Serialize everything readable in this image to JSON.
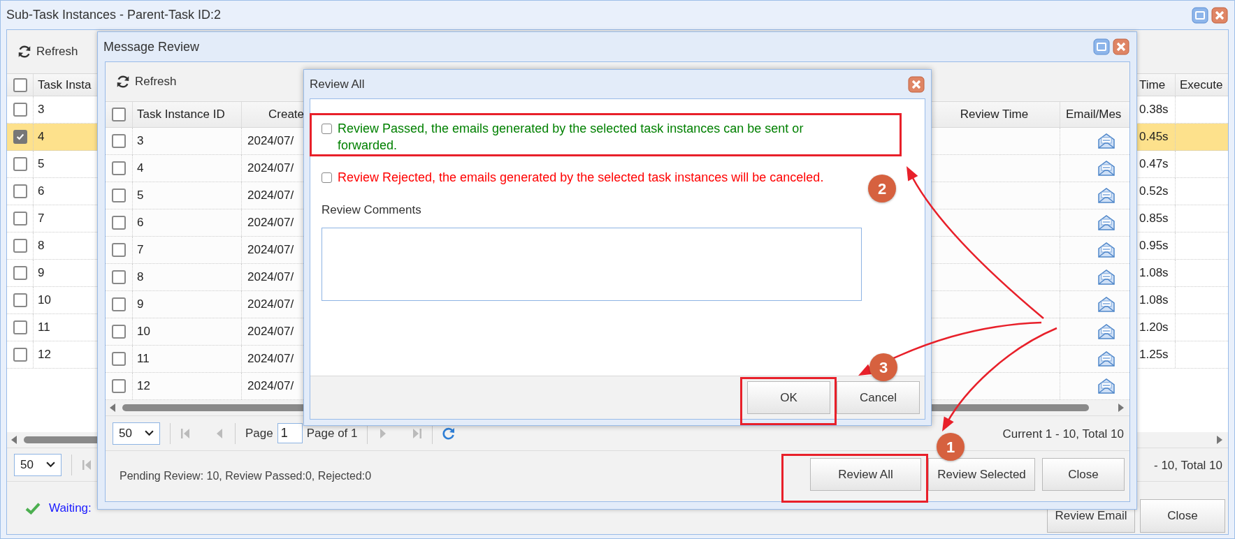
{
  "window": {
    "title": "Sub-Task Instances - Parent-Task ID:2",
    "refresh": "Refresh",
    "table": {
      "header_checked": false,
      "columns": [
        "Task Insta",
        "Time",
        "Execute"
      ],
      "rows": [
        {
          "checked": false,
          "selected": false,
          "id": "3",
          "time": "0.38s"
        },
        {
          "checked": true,
          "selected": true,
          "id": "4",
          "time": "0.45s"
        },
        {
          "checked": false,
          "selected": false,
          "id": "5",
          "time": "0.47s"
        },
        {
          "checked": false,
          "selected": false,
          "id": "6",
          "time": "0.52s"
        },
        {
          "checked": false,
          "selected": false,
          "id": "7",
          "time": "0.85s"
        },
        {
          "checked": false,
          "selected": false,
          "id": "8",
          "time": "0.95s"
        },
        {
          "checked": false,
          "selected": false,
          "id": "9",
          "time": "1.08s"
        },
        {
          "checked": false,
          "selected": false,
          "id": "10",
          "time": "1.08s"
        },
        {
          "checked": false,
          "selected": false,
          "id": "11",
          "time": "1.20s"
        },
        {
          "checked": false,
          "selected": false,
          "id": "12",
          "time": "1.25s"
        }
      ]
    },
    "pagination": {
      "page_size": "50",
      "summary": "- 10, Total 10"
    },
    "status": "Waiting:",
    "buttons": [
      "Review Email",
      "Close"
    ]
  },
  "message_review": {
    "title": "Message Review",
    "refresh": "Refresh",
    "table": {
      "header_checked": false,
      "columns": [
        "Task Instance ID",
        "Create",
        "Review Time",
        "Email/Mes"
      ],
      "rows": [
        {
          "checked": false,
          "id": "3",
          "created": "2024/07/"
        },
        {
          "checked": false,
          "id": "4",
          "created": "2024/07/"
        },
        {
          "checked": false,
          "id": "5",
          "created": "2024/07/"
        },
        {
          "checked": false,
          "id": "6",
          "created": "2024/07/"
        },
        {
          "checked": false,
          "id": "7",
          "created": "2024/07/"
        },
        {
          "checked": false,
          "id": "8",
          "created": "2024/07/"
        },
        {
          "checked": false,
          "id": "9",
          "created": "2024/07/"
        },
        {
          "checked": false,
          "id": "10",
          "created": "2024/07/"
        },
        {
          "checked": false,
          "id": "11",
          "created": "2024/07/"
        },
        {
          "checked": false,
          "id": "12",
          "created": "2024/07/"
        }
      ]
    },
    "pagination": {
      "page_size": "50",
      "page_label": "Page",
      "page": "1",
      "page_of": "Page of 1",
      "summary": "Current 1 - 10, Total 10"
    },
    "counts": "Pending Review: 10, Review Passed:0, Rejected:0",
    "buttons": [
      "Review All",
      "Review Selected",
      "Close"
    ]
  },
  "review_all": {
    "title": "Review All",
    "options": [
      {
        "label": "Review Passed, the emails generated by the selected task instances can be sent or forwarded.",
        "checked": false,
        "color": "#008000"
      },
      {
        "label": "Review Rejected, the emails generated by the selected task instances will be canceled.",
        "checked": false,
        "color": "#ff0000"
      }
    ],
    "comments_label": "Review Comments",
    "buttons": [
      "OK",
      "Cancel"
    ]
  },
  "annotations": [
    {
      "number": "1"
    },
    {
      "number": "2"
    },
    {
      "number": "3"
    }
  ]
}
